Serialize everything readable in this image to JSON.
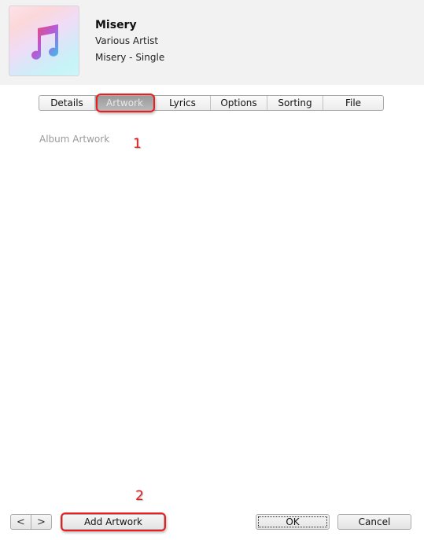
{
  "header": {
    "artwork_icon": "music-note-icon",
    "title": "Misery",
    "artist": "Various Artist",
    "album": "Misery - Single"
  },
  "tabs": [
    {
      "label": "Details",
      "active": false
    },
    {
      "label": "Artwork",
      "active": true
    },
    {
      "label": "Lyrics",
      "active": false
    },
    {
      "label": "Options",
      "active": false
    },
    {
      "label": "Sorting",
      "active": false
    },
    {
      "label": "File",
      "active": false
    }
  ],
  "content": {
    "section_label": "Album Artwork"
  },
  "annotations": {
    "step1": "1",
    "step2": "2",
    "highlight_color": "#ee1c1c"
  },
  "footer": {
    "prev_icon": "<",
    "next_icon": ">",
    "add_artwork_label": "Add Artwork",
    "ok_label": "OK",
    "cancel_label": "Cancel"
  }
}
